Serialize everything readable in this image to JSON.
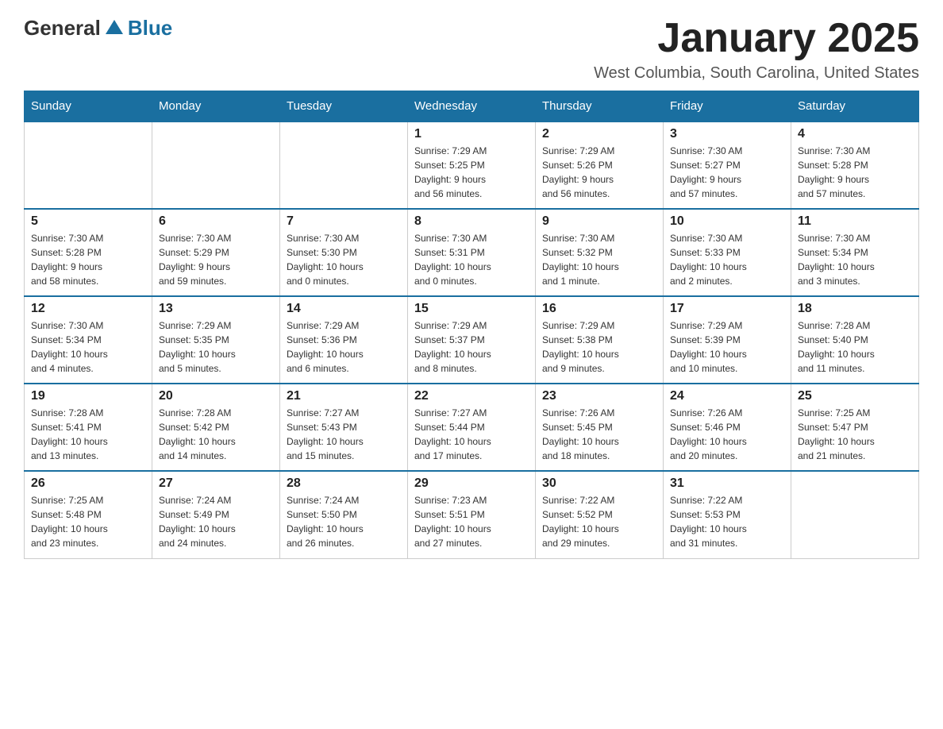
{
  "header": {
    "logo_general": "General",
    "logo_blue": "Blue",
    "month_year": "January 2025",
    "location": "West Columbia, South Carolina, United States"
  },
  "days_of_week": [
    "Sunday",
    "Monday",
    "Tuesday",
    "Wednesday",
    "Thursday",
    "Friday",
    "Saturday"
  ],
  "weeks": [
    [
      {
        "day": "",
        "info": ""
      },
      {
        "day": "",
        "info": ""
      },
      {
        "day": "",
        "info": ""
      },
      {
        "day": "1",
        "info": "Sunrise: 7:29 AM\nSunset: 5:25 PM\nDaylight: 9 hours\nand 56 minutes."
      },
      {
        "day": "2",
        "info": "Sunrise: 7:29 AM\nSunset: 5:26 PM\nDaylight: 9 hours\nand 56 minutes."
      },
      {
        "day": "3",
        "info": "Sunrise: 7:30 AM\nSunset: 5:27 PM\nDaylight: 9 hours\nand 57 minutes."
      },
      {
        "day": "4",
        "info": "Sunrise: 7:30 AM\nSunset: 5:28 PM\nDaylight: 9 hours\nand 57 minutes."
      }
    ],
    [
      {
        "day": "5",
        "info": "Sunrise: 7:30 AM\nSunset: 5:28 PM\nDaylight: 9 hours\nand 58 minutes."
      },
      {
        "day": "6",
        "info": "Sunrise: 7:30 AM\nSunset: 5:29 PM\nDaylight: 9 hours\nand 59 minutes."
      },
      {
        "day": "7",
        "info": "Sunrise: 7:30 AM\nSunset: 5:30 PM\nDaylight: 10 hours\nand 0 minutes."
      },
      {
        "day": "8",
        "info": "Sunrise: 7:30 AM\nSunset: 5:31 PM\nDaylight: 10 hours\nand 0 minutes."
      },
      {
        "day": "9",
        "info": "Sunrise: 7:30 AM\nSunset: 5:32 PM\nDaylight: 10 hours\nand 1 minute."
      },
      {
        "day": "10",
        "info": "Sunrise: 7:30 AM\nSunset: 5:33 PM\nDaylight: 10 hours\nand 2 minutes."
      },
      {
        "day": "11",
        "info": "Sunrise: 7:30 AM\nSunset: 5:34 PM\nDaylight: 10 hours\nand 3 minutes."
      }
    ],
    [
      {
        "day": "12",
        "info": "Sunrise: 7:30 AM\nSunset: 5:34 PM\nDaylight: 10 hours\nand 4 minutes."
      },
      {
        "day": "13",
        "info": "Sunrise: 7:29 AM\nSunset: 5:35 PM\nDaylight: 10 hours\nand 5 minutes."
      },
      {
        "day": "14",
        "info": "Sunrise: 7:29 AM\nSunset: 5:36 PM\nDaylight: 10 hours\nand 6 minutes."
      },
      {
        "day": "15",
        "info": "Sunrise: 7:29 AM\nSunset: 5:37 PM\nDaylight: 10 hours\nand 8 minutes."
      },
      {
        "day": "16",
        "info": "Sunrise: 7:29 AM\nSunset: 5:38 PM\nDaylight: 10 hours\nand 9 minutes."
      },
      {
        "day": "17",
        "info": "Sunrise: 7:29 AM\nSunset: 5:39 PM\nDaylight: 10 hours\nand 10 minutes."
      },
      {
        "day": "18",
        "info": "Sunrise: 7:28 AM\nSunset: 5:40 PM\nDaylight: 10 hours\nand 11 minutes."
      }
    ],
    [
      {
        "day": "19",
        "info": "Sunrise: 7:28 AM\nSunset: 5:41 PM\nDaylight: 10 hours\nand 13 minutes."
      },
      {
        "day": "20",
        "info": "Sunrise: 7:28 AM\nSunset: 5:42 PM\nDaylight: 10 hours\nand 14 minutes."
      },
      {
        "day": "21",
        "info": "Sunrise: 7:27 AM\nSunset: 5:43 PM\nDaylight: 10 hours\nand 15 minutes."
      },
      {
        "day": "22",
        "info": "Sunrise: 7:27 AM\nSunset: 5:44 PM\nDaylight: 10 hours\nand 17 minutes."
      },
      {
        "day": "23",
        "info": "Sunrise: 7:26 AM\nSunset: 5:45 PM\nDaylight: 10 hours\nand 18 minutes."
      },
      {
        "day": "24",
        "info": "Sunrise: 7:26 AM\nSunset: 5:46 PM\nDaylight: 10 hours\nand 20 minutes."
      },
      {
        "day": "25",
        "info": "Sunrise: 7:25 AM\nSunset: 5:47 PM\nDaylight: 10 hours\nand 21 minutes."
      }
    ],
    [
      {
        "day": "26",
        "info": "Sunrise: 7:25 AM\nSunset: 5:48 PM\nDaylight: 10 hours\nand 23 minutes."
      },
      {
        "day": "27",
        "info": "Sunrise: 7:24 AM\nSunset: 5:49 PM\nDaylight: 10 hours\nand 24 minutes."
      },
      {
        "day": "28",
        "info": "Sunrise: 7:24 AM\nSunset: 5:50 PM\nDaylight: 10 hours\nand 26 minutes."
      },
      {
        "day": "29",
        "info": "Sunrise: 7:23 AM\nSunset: 5:51 PM\nDaylight: 10 hours\nand 27 minutes."
      },
      {
        "day": "30",
        "info": "Sunrise: 7:22 AM\nSunset: 5:52 PM\nDaylight: 10 hours\nand 29 minutes."
      },
      {
        "day": "31",
        "info": "Sunrise: 7:22 AM\nSunset: 5:53 PM\nDaylight: 10 hours\nand 31 minutes."
      },
      {
        "day": "",
        "info": ""
      }
    ]
  ]
}
